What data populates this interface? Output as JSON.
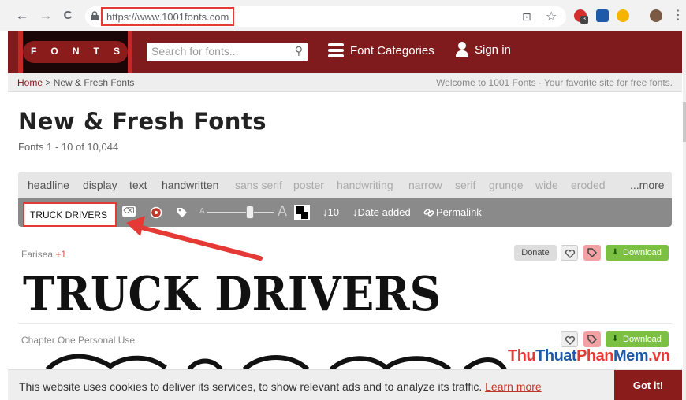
{
  "browser": {
    "url": "https://www.1001fonts.com",
    "back_glyph": "←",
    "forward_glyph": "→",
    "reload_glyph": "C",
    "menu_glyph": "⋮",
    "star_glyph": "☆",
    "translate_glyph": "⊡",
    "ext_badge": "3"
  },
  "header": {
    "logo_letters": [
      "F",
      "O",
      "N",
      "T",
      "S"
    ],
    "search_placeholder": "Search for fonts...",
    "search_glyph": "⚲",
    "categories_label": "Font Categories",
    "signin_label": "Sign in",
    "bg_color": "#7f1b1c"
  },
  "breadcrumb": {
    "home": "Home",
    "sep": ">",
    "current": "New & Fresh Fonts",
    "welcome": "Welcome to 1001 Fonts · Your favorite site for free fonts."
  },
  "page": {
    "title": "New & Fresh Fonts",
    "subtitle": "Fonts 1 - 10 of 10,044"
  },
  "filters": [
    {
      "label": "headline",
      "dim": false
    },
    {
      "label": "display",
      "dim": false
    },
    {
      "label": "text",
      "dim": false
    },
    {
      "label": "handwritten",
      "dim": false
    },
    {
      "label": "sans serif",
      "dim": true
    },
    {
      "label": "poster",
      "dim": true
    },
    {
      "label": "handwriting",
      "dim": true
    },
    {
      "label": "narrow",
      "dim": true
    },
    {
      "label": "serif",
      "dim": true
    },
    {
      "label": "grunge",
      "dim": true
    },
    {
      "label": "wide",
      "dim": true
    },
    {
      "label": "eroded",
      "dim": true
    },
    {
      "label": "...more",
      "dim": false
    }
  ],
  "toolbar": {
    "preview_text": "TRUCK DRIVERS",
    "clear_glyph": "⌫",
    "size_small": "A",
    "size_big": "A",
    "size_level": 0.64,
    "per_page": "↓10",
    "sort": "↓Date added",
    "permalink": "Permalink"
  },
  "fonts": [
    {
      "name": "Farisea",
      "plus": "+1",
      "sample": "TRUCK DRIVERS",
      "donate_label": "Donate",
      "download_label": "Download"
    },
    {
      "name": "Chapter One Personal Use",
      "plus": "",
      "sample": "TRUCK DRIVERS",
      "download_label": "Download"
    }
  ],
  "cookie": {
    "text": "This website uses cookies to deliver its services, to show relevant ads and to analyze its traffic.",
    "learn_more": "Learn more",
    "got_it": "Got it!"
  },
  "watermark": {
    "part1": "Thu",
    "part2": "Thuat",
    "part3": "Phan",
    "part4": "Mem",
    "part5": ".vn"
  }
}
